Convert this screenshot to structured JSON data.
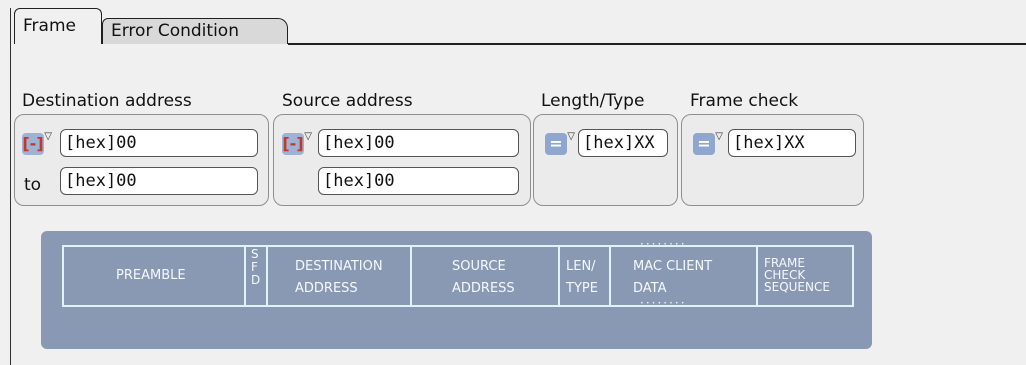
{
  "tabs": [
    {
      "label": "Frame"
    },
    {
      "label": "Error Condition"
    }
  ],
  "groups": {
    "destination": {
      "label": "Destination address",
      "operator_icon": "range-icon",
      "value_from": "[hex]00",
      "to_label": "to",
      "value_to": "[hex]00"
    },
    "source": {
      "label": "Source address",
      "operator_icon": "range-icon",
      "value_from": "[hex]00",
      "value_to": "[hex]00"
    },
    "length_type": {
      "label": "Length/Type",
      "operator_icon": "equals-icon",
      "operator": "=",
      "value": "[hex]XX"
    },
    "frame_check": {
      "label": "Frame check",
      "operator_icon": "equals-icon",
      "operator": "=",
      "value": "[hex]XX"
    }
  },
  "diagram": {
    "segments": [
      {
        "text": "PREAMBLE"
      },
      {
        "text": "S\nF\nD"
      },
      {
        "text": "DESTINATION\nADDRESS"
      },
      {
        "text": "SOURCE\nADDRESS"
      },
      {
        "text": "LEN/\nTYPE"
      },
      {
        "text": "MAC CLIENT\nDATA"
      },
      {
        "text": "FRAME\nCHECK\nSEQUENCE"
      }
    ]
  },
  "colors": {
    "operator_bg": "#9fb2d4",
    "diagram_bg": "#8a99b3",
    "diagram_line": "#dff3ff"
  }
}
